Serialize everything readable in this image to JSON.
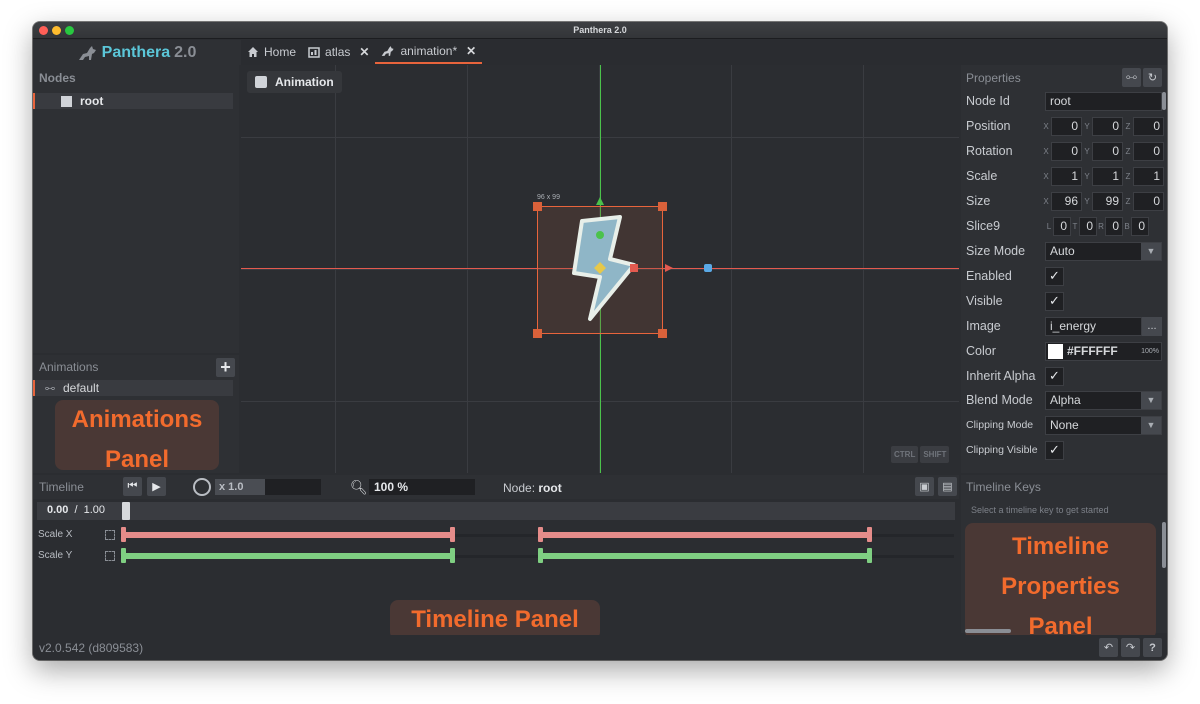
{
  "window": {
    "title": "Panthera 2.0"
  },
  "logo": {
    "name": "Panthera",
    "version": "2.0"
  },
  "tabs": [
    {
      "label": "Home",
      "icon": "home-icon",
      "closable": false,
      "active": false
    },
    {
      "label": "atlas",
      "icon": "atlas-icon",
      "closable": true,
      "active": false
    },
    {
      "label": "animation*",
      "icon": "panther-icon",
      "closable": true,
      "active": true
    }
  ],
  "nodes_panel": {
    "title": "Nodes",
    "items": [
      {
        "label": "root"
      }
    ]
  },
  "animations_panel": {
    "title": "Animations",
    "items": [
      {
        "label": "default"
      }
    ]
  },
  "viewport": {
    "mode_label": "Animation",
    "size_label": "96 x 99",
    "keys": [
      "CTRL",
      "SHIFT"
    ]
  },
  "properties": {
    "title": "Properties",
    "node_id_label": "Node Id",
    "node_id": "root",
    "position": {
      "label": "Position",
      "x": "0",
      "y": "0",
      "z": "0"
    },
    "rotation": {
      "label": "Rotation",
      "x": "0",
      "y": "0",
      "z": "0"
    },
    "scale": {
      "label": "Scale",
      "x": "1",
      "y": "1",
      "z": "1"
    },
    "size": {
      "label": "Size",
      "x": "96",
      "y": "99",
      "z": "0"
    },
    "slice9": {
      "label": "Slice9",
      "l": "0",
      "t": "0",
      "r": "0",
      "b": "0"
    },
    "size_mode": {
      "label": "Size Mode",
      "value": "Auto"
    },
    "enabled": {
      "label": "Enabled",
      "checked": true
    },
    "visible": {
      "label": "Visible",
      "checked": true
    },
    "image": {
      "label": "Image",
      "value": "i_energy",
      "browse": "..."
    },
    "color": {
      "label": "Color",
      "value": "#FFFFFF",
      "alpha": "100%"
    },
    "inherit_alpha": {
      "label": "Inherit Alpha",
      "checked": true
    },
    "blend_mode": {
      "label": "Blend Mode",
      "value": "Alpha"
    },
    "clipping_mode": {
      "label": "Clipping Mode",
      "value": "None"
    },
    "clipping_visible": {
      "label": "Clipping Visible",
      "checked": true
    },
    "axis_letters": {
      "x": "X",
      "y": "Y",
      "z": "Z",
      "l": "L",
      "t": "T",
      "r": "R",
      "b": "B"
    }
  },
  "timeline": {
    "title": "Timeline",
    "speed": "x 1.0",
    "zoom": "100 %",
    "node_prefix": "Node:",
    "node_name": "root",
    "current_time": "0.00",
    "separator": "/",
    "duration": "1.00",
    "tracks": [
      {
        "label": "Scale X",
        "color": "#e58c8a"
      },
      {
        "label": "Scale Y",
        "color": "#7fcf82"
      }
    ]
  },
  "timeline_keys": {
    "title": "Timeline Keys",
    "hint": "Select a timeline key to get started"
  },
  "callouts": {
    "animations": "Animations Panel",
    "timeline": "Timeline Panel",
    "timeline_props": "Timeline Properties Panel"
  },
  "status": {
    "version": "v2.0.542 (d809583)"
  },
  "colors": {
    "accent": "#e8643c",
    "logo": "#5bc6d8",
    "axis_x": "#e45a4f",
    "axis_y": "#4bc24b"
  }
}
